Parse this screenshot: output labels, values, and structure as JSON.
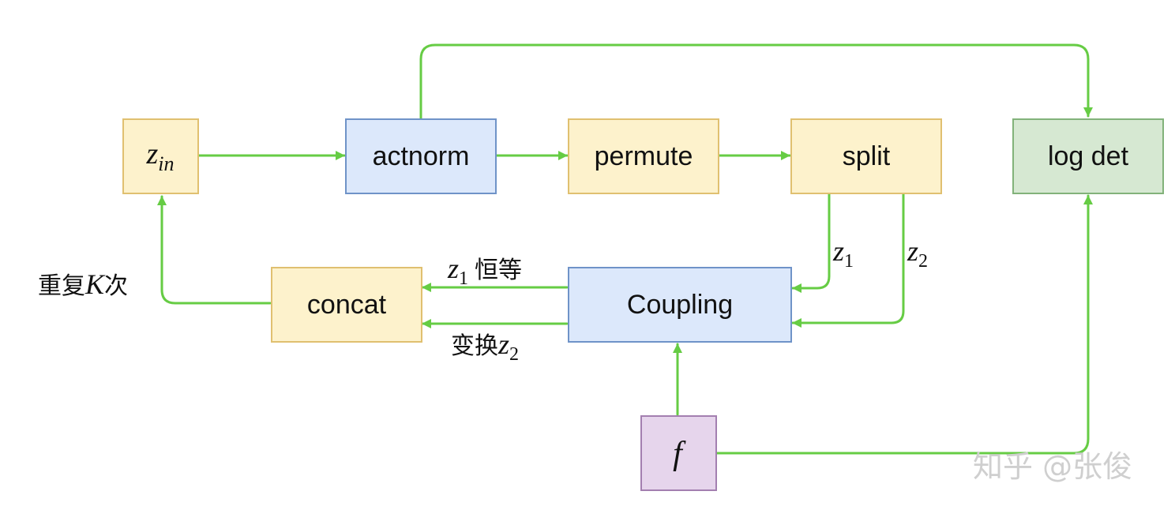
{
  "colors": {
    "edge": "#66cc44",
    "yellow_fill": "#fdf2cc",
    "yellow_stroke": "#e0c070",
    "blue_fill": "#dce8fb",
    "blue_stroke": "#6f93c8",
    "green_fill": "#d6e8d2",
    "green_stroke": "#82b27a",
    "purple_fill": "#e6d5ec",
    "purple_stroke": "#a37fb0"
  },
  "nodes": {
    "z_in": {
      "main": "z",
      "sub": "in"
    },
    "actnorm": "actnorm",
    "permute": "permute",
    "split": "split",
    "log_det": "log det",
    "concat": "concat",
    "coupling": "Coupling",
    "f": "f"
  },
  "edge_labels": {
    "z1": {
      "main": "z",
      "sub": "1"
    },
    "z2": {
      "main": "z",
      "sub": "2"
    },
    "z1_identity": {
      "main": "z",
      "sub": "1",
      "text": "恒等"
    },
    "transform_z2": {
      "text": "变换",
      "main": "z",
      "sub": "2"
    },
    "repeat_k": {
      "pre": "重复",
      "k": "K",
      "post": "次"
    }
  },
  "watermark": "知乎 @张俊"
}
